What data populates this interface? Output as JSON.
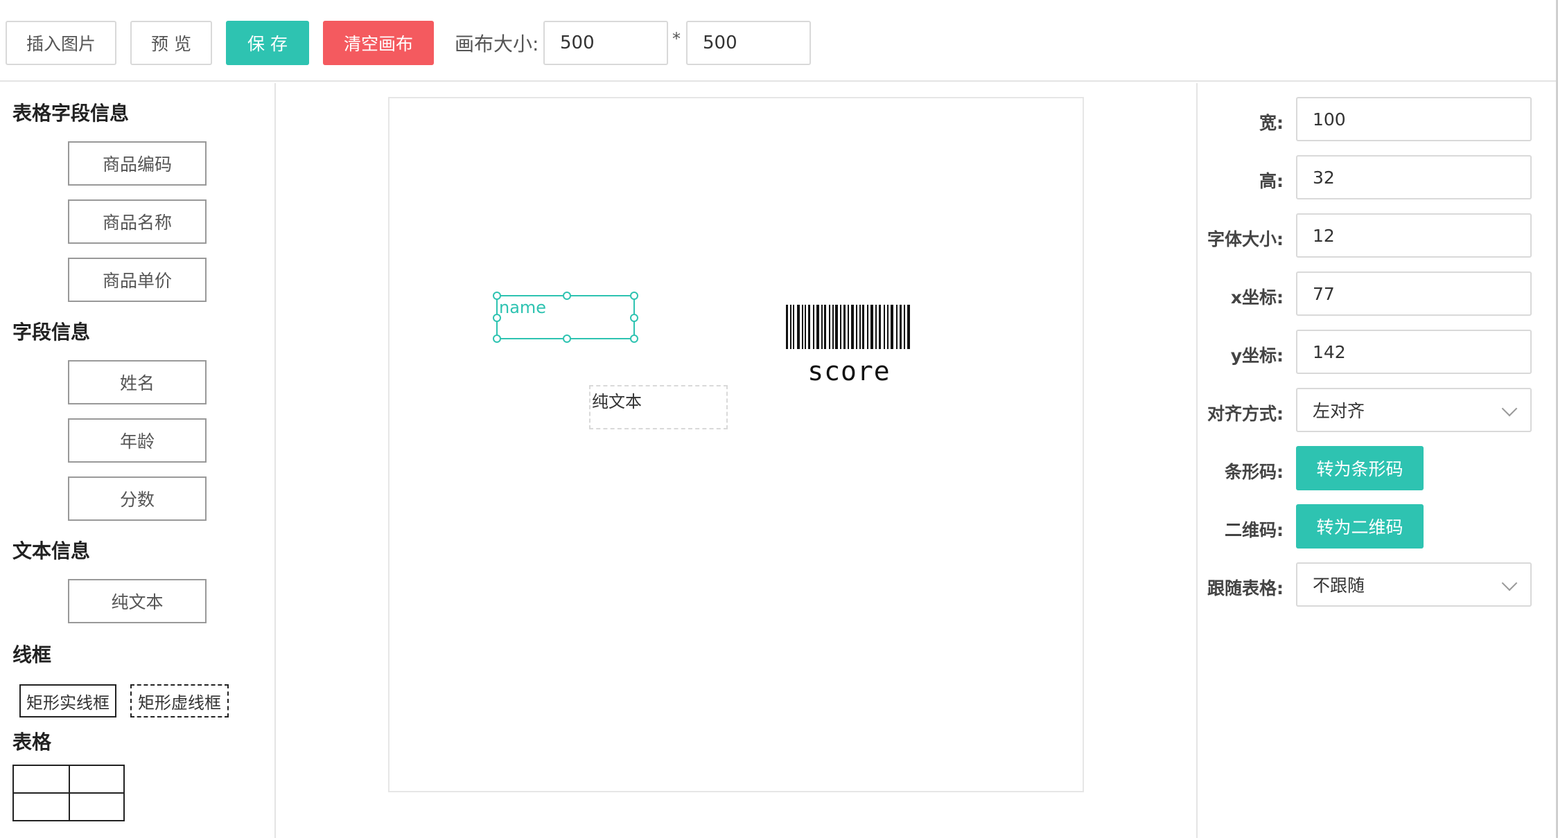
{
  "toolbar": {
    "insert_image_label": "插入图片",
    "preview_label": "预 览",
    "save_label": "保 存",
    "clear_canvas_label": "清空画布",
    "canvas_size_label": "画布大小:",
    "canvas_width_value": "500",
    "size_separator": "*",
    "canvas_height_value": "500"
  },
  "sidebar": {
    "table_fields_title": "表格字段信息",
    "table_fields": [
      "商品编码",
      "商品名称",
      "商品单价"
    ],
    "fields_title": "字段信息",
    "fields": [
      "姓名",
      "年龄",
      "分数"
    ],
    "text_title": "文本信息",
    "text_items": [
      "纯文本"
    ],
    "frame_title": "线框",
    "solid_frame_label": "矩形实线框",
    "dashed_frame_label": "矩形虚线框",
    "table_title": "表格"
  },
  "canvas": {
    "name_element_text": "name",
    "plain_text_element": "纯文本",
    "barcode_label": "score"
  },
  "properties": {
    "width_label": "宽:",
    "width_value": "100",
    "height_label": "高:",
    "height_value": "32",
    "font_size_label": "字体大小:",
    "font_size_value": "12",
    "x_label": "x坐标:",
    "x_value": "77",
    "y_label": "y坐标:",
    "y_value": "142",
    "align_label": "对齐方式:",
    "align_value": "左对齐",
    "barcode_label": "条形码:",
    "barcode_button": "转为条形码",
    "qrcode_label": "二维码:",
    "qrcode_button": "转为二维码",
    "follow_table_label": "跟随表格:",
    "follow_table_value": "不跟随"
  },
  "colors": {
    "accent": "#2ec3b1",
    "danger": "#f45a5f"
  }
}
